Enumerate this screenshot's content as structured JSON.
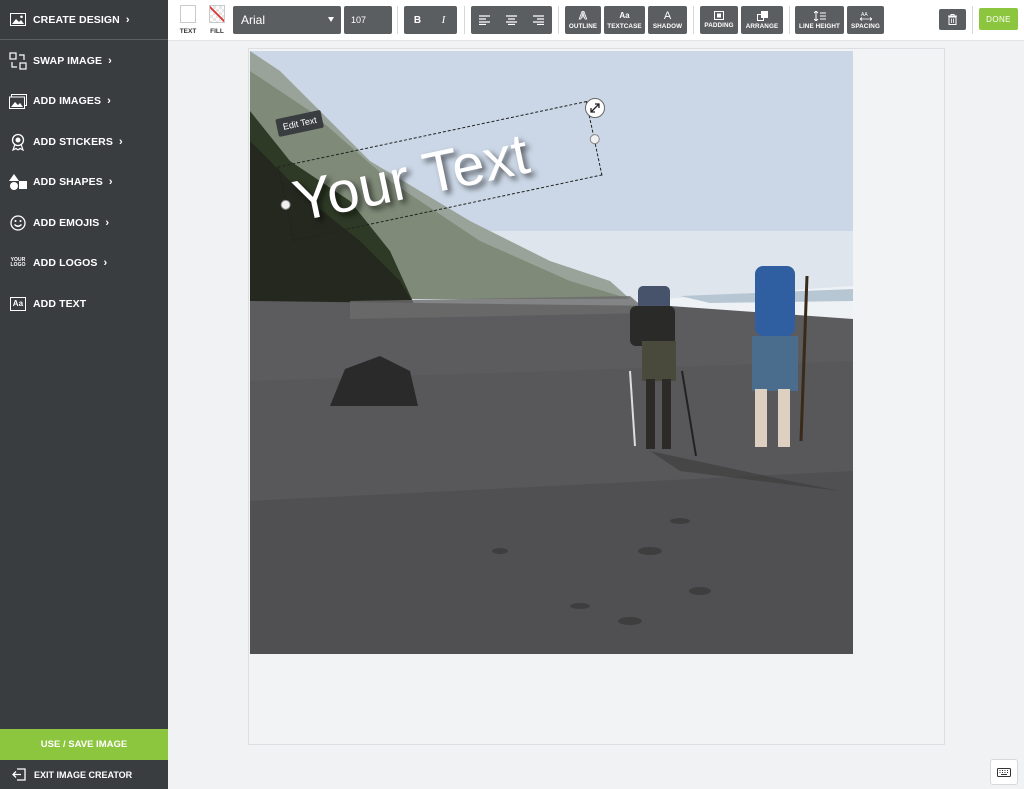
{
  "sidebar": {
    "items": [
      {
        "label": "CREATE DESIGN",
        "icon": "image-icon"
      },
      {
        "label": "SWAP IMAGE",
        "icon": "swap-icon"
      },
      {
        "label": "ADD IMAGES",
        "icon": "images-icon"
      },
      {
        "label": "ADD STICKERS",
        "icon": "badge-icon"
      },
      {
        "label": "ADD SHAPES",
        "icon": "shapes-icon"
      },
      {
        "label": "ADD EMOJIS",
        "icon": "smiley-icon"
      },
      {
        "label": "ADD LOGOS",
        "icon": "logo-icon",
        "icon_text": "YOUR LOGO"
      },
      {
        "label": "ADD TEXT",
        "icon": "text-icon",
        "icon_text": "Aa"
      }
    ],
    "use_save": "USE / SAVE IMAGE",
    "exit": "EXIT IMAGE CREATOR"
  },
  "toolbar": {
    "text_color_label": "TEXT",
    "fill_label": "FILL",
    "font": "Arial",
    "font_size": "107",
    "bold": "B",
    "italic": "I",
    "outline_glyph": "A",
    "outline": "OUTLINE",
    "textcase_glyph": "Aa",
    "textcase": "TEXTCASE",
    "shadow_glyph": "A",
    "shadow": "SHADOW",
    "padding": "PADDING",
    "arrange": "ARRANGE",
    "line_height": "LINE HEIGHT",
    "spacing": "SPACING",
    "done": "DONE"
  },
  "canvas": {
    "edit_tag": "Edit Text",
    "text": "Your Text"
  },
  "colors": {
    "sidebar": "#3a3d40",
    "accent": "#8cc63f",
    "toolbar_button": "#5b5e61"
  }
}
